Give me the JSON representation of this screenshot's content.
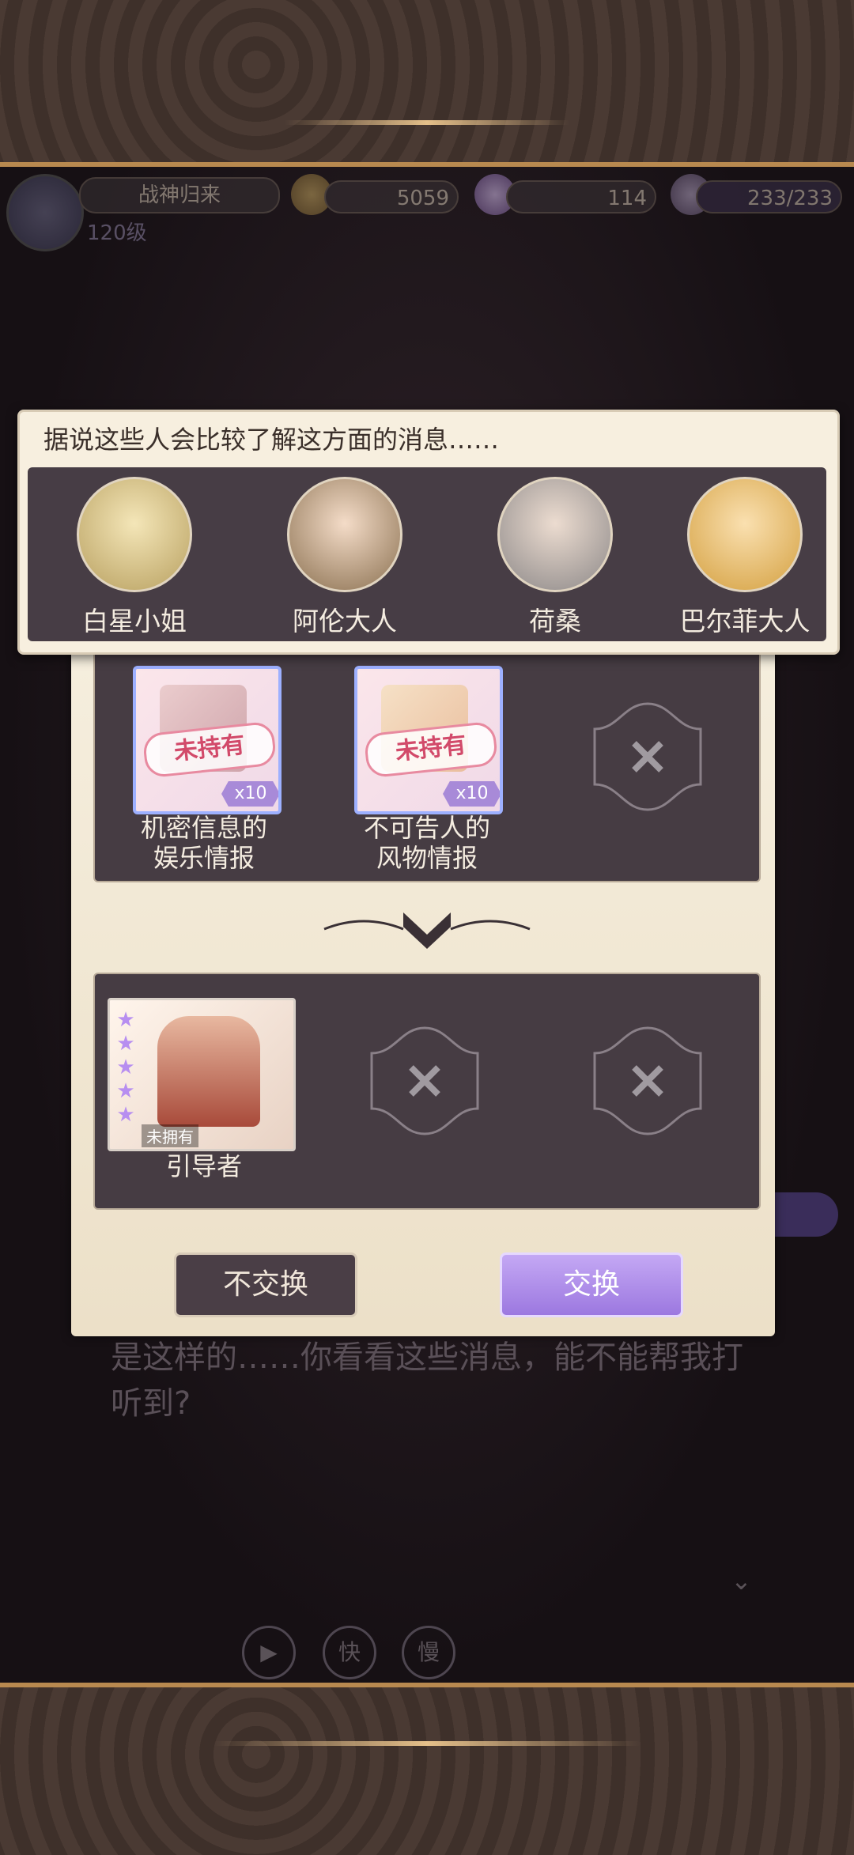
{
  "status": {
    "title": "战神归来",
    "level": "120级",
    "coins": "5059",
    "gems": "114",
    "stamina": "233/233"
  },
  "popup": {
    "title": "据说这些人会比较了解这方面的消息……",
    "npcs": [
      {
        "name": "白星小姐"
      },
      {
        "name": "阿伦大人"
      },
      {
        "name": "荷桑"
      },
      {
        "name": "巴尔菲大人"
      }
    ]
  },
  "exchange": {
    "give_items": [
      {
        "label_line1": "机密信息的",
        "label_line2": "娱乐情报",
        "stamp": "未持有",
        "qty": "x10"
      },
      {
        "label_line1": "不可告人的",
        "label_line2": "风物情报",
        "stamp": "未持有",
        "qty": "x10"
      }
    ],
    "reward": {
      "name": "引导者",
      "status": "未拥有",
      "stars": "★★★★★"
    },
    "no_exchange_label": "不交换",
    "exchange_label": "交换"
  },
  "dialogue": {
    "text": "是这样的……你看看这些消息，能不能帮我打听到?"
  },
  "controls": {
    "fast": "快",
    "slow": "慢"
  }
}
